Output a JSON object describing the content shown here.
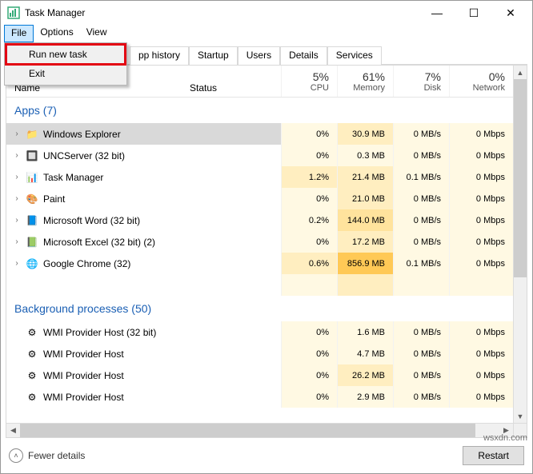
{
  "window": {
    "title": "Task Manager"
  },
  "menubar": {
    "file": "File",
    "options": "Options",
    "view": "View"
  },
  "dropdown": {
    "run_new_task": "Run new task",
    "exit": "Exit"
  },
  "tabs": {
    "app_history": "pp history",
    "startup": "Startup",
    "users": "Users",
    "details": "Details",
    "services": "Services"
  },
  "columns": {
    "name": "Name",
    "status": "Status",
    "cpu_pct": "5%",
    "cpu": "CPU",
    "mem_pct": "61%",
    "mem": "Memory",
    "disk_pct": "7%",
    "disk": "Disk",
    "net_pct": "0%",
    "net": "Network"
  },
  "groups": {
    "apps": "Apps (7)",
    "bg": "Background processes (50)"
  },
  "rows": [
    {
      "name": "Windows Explorer",
      "cpu": "0%",
      "mem": "30.9 MB",
      "disk": "0 MB/s",
      "net": "0 Mbps",
      "ico": "📁",
      "sel": true
    },
    {
      "name": "UNCServer (32 bit)",
      "cpu": "0%",
      "mem": "0.3 MB",
      "disk": "0 MB/s",
      "net": "0 Mbps",
      "ico": "🔲"
    },
    {
      "name": "Task Manager",
      "cpu": "1.2%",
      "mem": "21.4 MB",
      "disk": "0.1 MB/s",
      "net": "0 Mbps",
      "ico": "📊"
    },
    {
      "name": "Paint",
      "cpu": "0%",
      "mem": "21.0 MB",
      "disk": "0 MB/s",
      "net": "0 Mbps",
      "ico": "🎨"
    },
    {
      "name": "Microsoft Word (32 bit)",
      "cpu": "0.2%",
      "mem": "144.0 MB",
      "disk": "0 MB/s",
      "net": "0 Mbps",
      "ico": "📘"
    },
    {
      "name": "Microsoft Excel (32 bit) (2)",
      "cpu": "0%",
      "mem": "17.2 MB",
      "disk": "0 MB/s",
      "net": "0 Mbps",
      "ico": "📗"
    },
    {
      "name": "Google Chrome (32)",
      "cpu": "0.6%",
      "mem": "856.9 MB",
      "disk": "0.1 MB/s",
      "net": "0 Mbps",
      "ico": "🌐"
    }
  ],
  "bg_rows": [
    {
      "name": "WMI Provider Host (32 bit)",
      "cpu": "0%",
      "mem": "1.6 MB",
      "disk": "0 MB/s",
      "net": "0 Mbps",
      "ico": "⚙"
    },
    {
      "name": "WMI Provider Host",
      "cpu": "0%",
      "mem": "4.7 MB",
      "disk": "0 MB/s",
      "net": "0 Mbps",
      "ico": "⚙"
    },
    {
      "name": "WMI Provider Host",
      "cpu": "0%",
      "mem": "26.2 MB",
      "disk": "0 MB/s",
      "net": "0 Mbps",
      "ico": "⚙"
    },
    {
      "name": "WMI Provider Host",
      "cpu": "0%",
      "mem": "2.9 MB",
      "disk": "0 MB/s",
      "net": "0 Mbps",
      "ico": "⚙"
    }
  ],
  "mem_heat": [
    "h1",
    "h0",
    "h1",
    "h1",
    "h2",
    "h1",
    "h4"
  ],
  "cpu_heat": [
    "h0",
    "h0",
    "h1",
    "h0",
    "h0",
    "h0",
    "h1"
  ],
  "footer": {
    "fewer": "Fewer details",
    "restart": "Restart"
  },
  "watermark": "wsxdn.com"
}
